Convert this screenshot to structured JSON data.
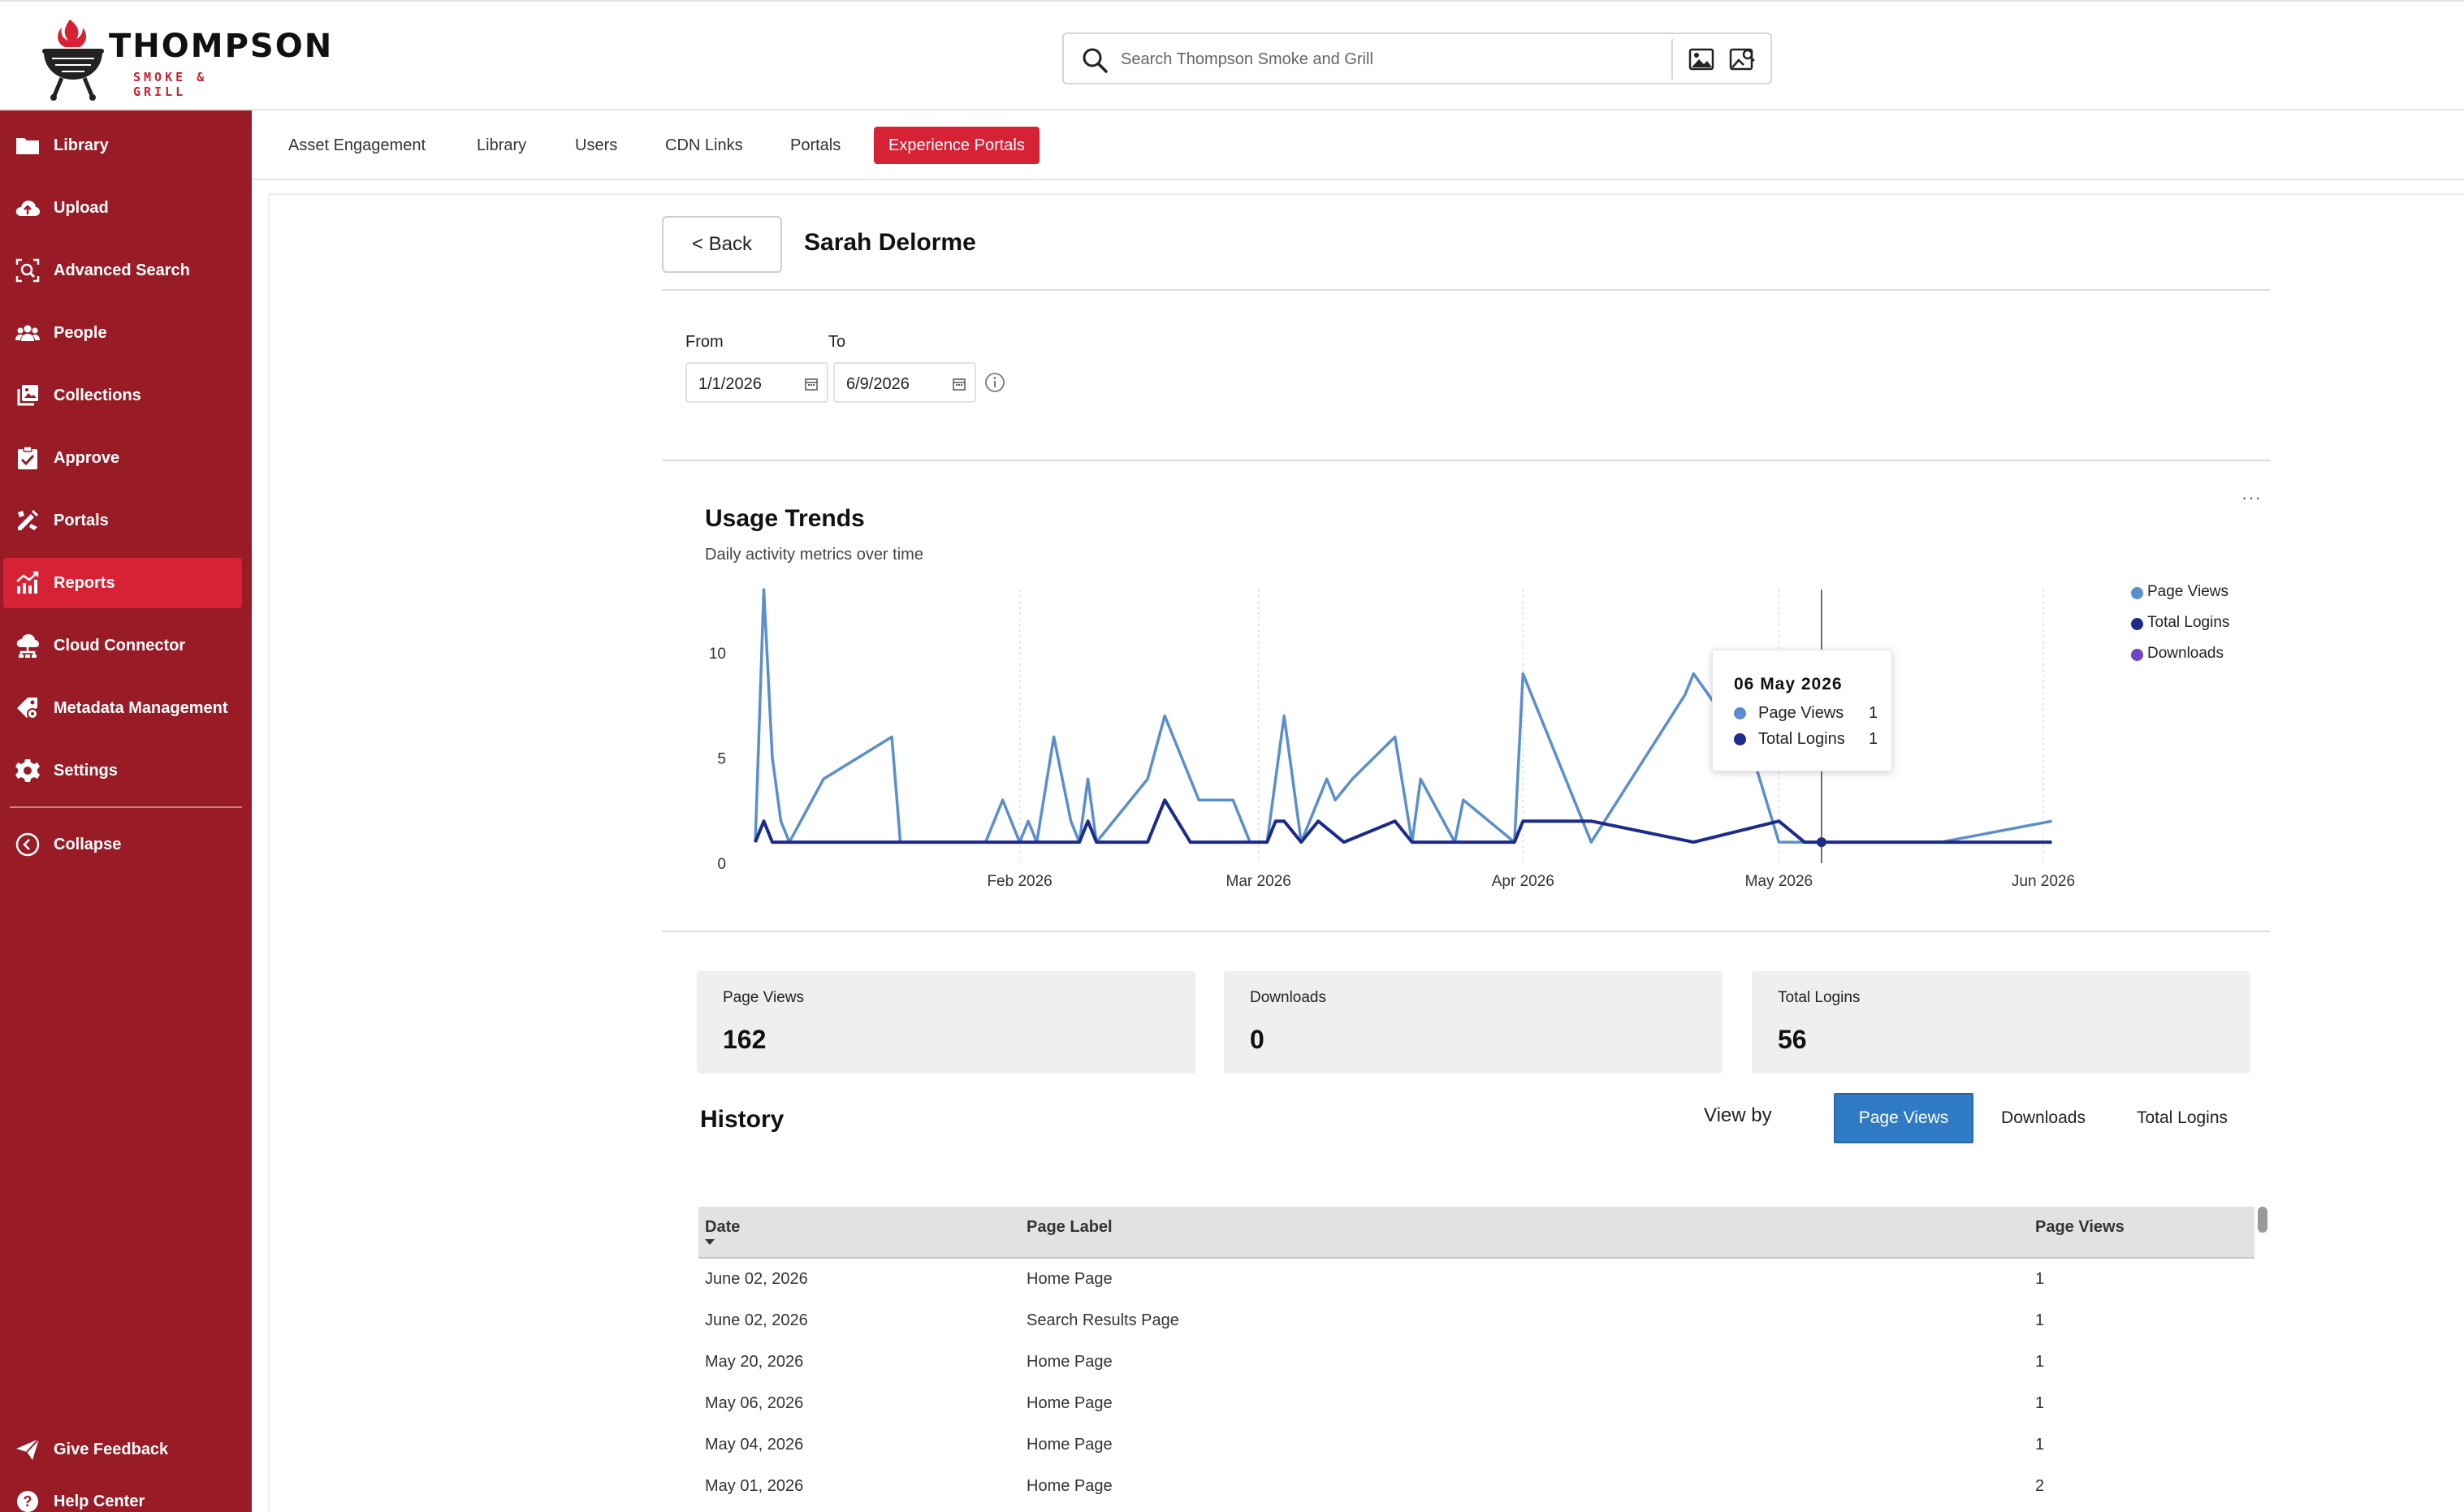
{
  "brand": {
    "name": "THOMPSON",
    "tagline": "SMOKE & GRILL",
    "accent": "#d62234",
    "sidebar_bg": "#981b26"
  },
  "search": {
    "placeholder": "Search Thompson Smoke and Grill"
  },
  "sidebar": {
    "items": [
      {
        "label": "Library",
        "icon": "folder-icon"
      },
      {
        "label": "Upload",
        "icon": "cloud-upload-icon"
      },
      {
        "label": "Advanced Search",
        "icon": "advanced-search-icon"
      },
      {
        "label": "People",
        "icon": "people-icon"
      },
      {
        "label": "Collections",
        "icon": "collections-icon"
      },
      {
        "label": "Approve",
        "icon": "approve-icon"
      },
      {
        "label": "Portals",
        "icon": "portals-icon"
      },
      {
        "label": "Reports",
        "icon": "reports-icon",
        "active": true
      },
      {
        "label": "Cloud Connector",
        "icon": "cloud-connector-icon"
      },
      {
        "label": "Metadata Management",
        "icon": "metadata-icon"
      },
      {
        "label": "Settings",
        "icon": "gear-icon"
      }
    ],
    "collapse_label": "Collapse",
    "feedback_label": "Give Feedback",
    "help_label": "Help Center"
  },
  "tabs": [
    {
      "label": "Asset Engagement"
    },
    {
      "label": "Library"
    },
    {
      "label": "Users"
    },
    {
      "label": "CDN Links"
    },
    {
      "label": "Portals"
    },
    {
      "label": "Experience Portals",
      "active": true
    }
  ],
  "detail": {
    "back_label": "< Back",
    "person_name": "Sarah Delorme"
  },
  "filters": {
    "from_label": "From",
    "to_label": "To",
    "from_value": "1/1/2026",
    "to_value": "6/9/2026"
  },
  "chart_card": {
    "title": "Usage Trends",
    "subtitle": "Daily activity metrics over time",
    "menu_label": "···"
  },
  "chart_data": {
    "type": "line",
    "title": "Usage Trends",
    "subtitle": "Daily activity metrics over time",
    "xlabel": "",
    "ylabel": "",
    "x_range": [
      "2026-01-01",
      "2026-06-09"
    ],
    "ylim": [
      0,
      13
    ],
    "y_ticks": [
      0,
      5,
      10
    ],
    "x_ticks": [
      {
        "date": "2026-02-01",
        "label": "Feb 2026"
      },
      {
        "date": "2026-03-01",
        "label": "Mar 2026"
      },
      {
        "date": "2026-04-01",
        "label": "Apr 2026"
      },
      {
        "date": "2026-05-01",
        "label": "May 2026"
      },
      {
        "date": "2026-06-01",
        "label": "Jun 2026"
      }
    ],
    "grid": true,
    "legend_position": "top-right",
    "series": [
      {
        "name": "Page Views",
        "color": "#5b8fcb",
        "points": [
          [
            "2026-01-01",
            1
          ],
          [
            "2026-01-02",
            13
          ],
          [
            "2026-01-03",
            5
          ],
          [
            "2026-01-04",
            2
          ],
          [
            "2026-01-05",
            1
          ],
          [
            "2026-01-09",
            4
          ],
          [
            "2026-01-17",
            6
          ],
          [
            "2026-01-18",
            1
          ],
          [
            "2026-01-28",
            1
          ],
          [
            "2026-01-30",
            3
          ],
          [
            "2026-01-31",
            2
          ],
          [
            "2026-02-01",
            1
          ],
          [
            "2026-02-02",
            2
          ],
          [
            "2026-02-03",
            1
          ],
          [
            "2026-02-05",
            6
          ],
          [
            "2026-02-07",
            2
          ],
          [
            "2026-02-08",
            1
          ],
          [
            "2026-02-09",
            4
          ],
          [
            "2026-02-10",
            1
          ],
          [
            "2026-02-16",
            4
          ],
          [
            "2026-02-18",
            7
          ],
          [
            "2026-02-20",
            5
          ],
          [
            "2026-02-22",
            3
          ],
          [
            "2026-02-26",
            3
          ],
          [
            "2026-02-28",
            1
          ],
          [
            "2026-03-02",
            1
          ],
          [
            "2026-03-04",
            7
          ],
          [
            "2026-03-06",
            1
          ],
          [
            "2026-03-09",
            4
          ],
          [
            "2026-03-10",
            3
          ],
          [
            "2026-03-12",
            4
          ],
          [
            "2026-03-17",
            6
          ],
          [
            "2026-03-19",
            1
          ],
          [
            "2026-03-20",
            4
          ],
          [
            "2026-03-24",
            1
          ],
          [
            "2026-03-25",
            3
          ],
          [
            "2026-03-31",
            1
          ],
          [
            "2026-04-01",
            9
          ],
          [
            "2026-04-09",
            1
          ],
          [
            "2026-04-20",
            8
          ],
          [
            "2026-04-21",
            9
          ],
          [
            "2026-04-28",
            5
          ],
          [
            "2026-05-01",
            1
          ],
          [
            "2026-05-06",
            1
          ],
          [
            "2026-05-20",
            1
          ],
          [
            "2026-06-02",
            2
          ]
        ]
      },
      {
        "name": "Total Logins",
        "color": "#1c2a8c",
        "points": [
          [
            "2026-01-01",
            1
          ],
          [
            "2026-01-02",
            2
          ],
          [
            "2026-01-03",
            1
          ],
          [
            "2026-02-08",
            1
          ],
          [
            "2026-02-09",
            2
          ],
          [
            "2026-02-10",
            1
          ],
          [
            "2026-02-16",
            1
          ],
          [
            "2026-02-18",
            3
          ],
          [
            "2026-02-21",
            1
          ],
          [
            "2026-03-02",
            1
          ],
          [
            "2026-03-03",
            2
          ],
          [
            "2026-03-04",
            2
          ],
          [
            "2026-03-06",
            1
          ],
          [
            "2026-03-08",
            2
          ],
          [
            "2026-03-11",
            1
          ],
          [
            "2026-03-17",
            2
          ],
          [
            "2026-03-19",
            1
          ],
          [
            "2026-03-31",
            1
          ],
          [
            "2026-04-01",
            2
          ],
          [
            "2026-04-09",
            2
          ],
          [
            "2026-04-21",
            1
          ],
          [
            "2026-05-01",
            2
          ],
          [
            "2026-05-04",
            1
          ],
          [
            "2026-05-06",
            1
          ],
          [
            "2026-06-02",
            1
          ]
        ]
      },
      {
        "name": "Downloads",
        "color": "#6f45c2",
        "points": []
      }
    ],
    "hover": {
      "date_label": "06 May 2026",
      "date": "2026-05-06",
      "rows": [
        {
          "name": "Page Views",
          "value": "1",
          "color": "#5b8fcb"
        },
        {
          "name": "Total Logins",
          "value": "1",
          "color": "#1c2a8c"
        }
      ]
    }
  },
  "metrics": [
    {
      "label": "Page Views",
      "value": "162"
    },
    {
      "label": "Downloads",
      "value": "0"
    },
    {
      "label": "Total Logins",
      "value": "56"
    }
  ],
  "history": {
    "title": "History",
    "view_by_label": "View by",
    "view_options": [
      {
        "label": "Page Views",
        "active": true
      },
      {
        "label": "Downloads"
      },
      {
        "label": "Total Logins"
      }
    ],
    "columns": [
      "Date",
      "Page Label",
      "Page Views"
    ],
    "rows": [
      [
        "June 02, 2026",
        "Home Page",
        "1"
      ],
      [
        "June 02, 2026",
        "Search Results Page",
        "1"
      ],
      [
        "May 20, 2026",
        "Home Page",
        "1"
      ],
      [
        "May 06, 2026",
        "Home Page",
        "1"
      ],
      [
        "May 04, 2026",
        "Home Page",
        "1"
      ],
      [
        "May 01, 2026",
        "Home Page",
        "2"
      ]
    ]
  }
}
